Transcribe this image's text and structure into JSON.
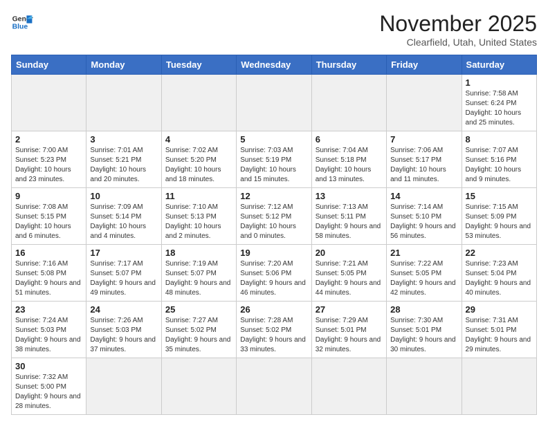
{
  "header": {
    "logo_line1": "General",
    "logo_line2": "Blue",
    "title": "November 2025",
    "subtitle": "Clearfield, Utah, United States"
  },
  "days_of_week": [
    "Sunday",
    "Monday",
    "Tuesday",
    "Wednesday",
    "Thursday",
    "Friday",
    "Saturday"
  ],
  "weeks": [
    [
      {
        "day": "",
        "info": ""
      },
      {
        "day": "",
        "info": ""
      },
      {
        "day": "",
        "info": ""
      },
      {
        "day": "",
        "info": ""
      },
      {
        "day": "",
        "info": ""
      },
      {
        "day": "",
        "info": ""
      },
      {
        "day": "1",
        "info": "Sunrise: 7:58 AM\nSunset: 6:24 PM\nDaylight: 10 hours\nand 25 minutes."
      }
    ],
    [
      {
        "day": "2",
        "info": "Sunrise: 7:00 AM\nSunset: 5:23 PM\nDaylight: 10 hours\nand 23 minutes."
      },
      {
        "day": "3",
        "info": "Sunrise: 7:01 AM\nSunset: 5:21 PM\nDaylight: 10 hours\nand 20 minutes."
      },
      {
        "day": "4",
        "info": "Sunrise: 7:02 AM\nSunset: 5:20 PM\nDaylight: 10 hours\nand 18 minutes."
      },
      {
        "day": "5",
        "info": "Sunrise: 7:03 AM\nSunset: 5:19 PM\nDaylight: 10 hours\nand 15 minutes."
      },
      {
        "day": "6",
        "info": "Sunrise: 7:04 AM\nSunset: 5:18 PM\nDaylight: 10 hours\nand 13 minutes."
      },
      {
        "day": "7",
        "info": "Sunrise: 7:06 AM\nSunset: 5:17 PM\nDaylight: 10 hours\nand 11 minutes."
      },
      {
        "day": "8",
        "info": "Sunrise: 7:07 AM\nSunset: 5:16 PM\nDaylight: 10 hours\nand 9 minutes."
      }
    ],
    [
      {
        "day": "9",
        "info": "Sunrise: 7:08 AM\nSunset: 5:15 PM\nDaylight: 10 hours\nand 6 minutes."
      },
      {
        "day": "10",
        "info": "Sunrise: 7:09 AM\nSunset: 5:14 PM\nDaylight: 10 hours\nand 4 minutes."
      },
      {
        "day": "11",
        "info": "Sunrise: 7:10 AM\nSunset: 5:13 PM\nDaylight: 10 hours\nand 2 minutes."
      },
      {
        "day": "12",
        "info": "Sunrise: 7:12 AM\nSunset: 5:12 PM\nDaylight: 10 hours\nand 0 minutes."
      },
      {
        "day": "13",
        "info": "Sunrise: 7:13 AM\nSunset: 5:11 PM\nDaylight: 9 hours\nand 58 minutes."
      },
      {
        "day": "14",
        "info": "Sunrise: 7:14 AM\nSunset: 5:10 PM\nDaylight: 9 hours\nand 56 minutes."
      },
      {
        "day": "15",
        "info": "Sunrise: 7:15 AM\nSunset: 5:09 PM\nDaylight: 9 hours\nand 53 minutes."
      }
    ],
    [
      {
        "day": "16",
        "info": "Sunrise: 7:16 AM\nSunset: 5:08 PM\nDaylight: 9 hours\nand 51 minutes."
      },
      {
        "day": "17",
        "info": "Sunrise: 7:17 AM\nSunset: 5:07 PM\nDaylight: 9 hours\nand 49 minutes."
      },
      {
        "day": "18",
        "info": "Sunrise: 7:19 AM\nSunset: 5:07 PM\nDaylight: 9 hours\nand 48 minutes."
      },
      {
        "day": "19",
        "info": "Sunrise: 7:20 AM\nSunset: 5:06 PM\nDaylight: 9 hours\nand 46 minutes."
      },
      {
        "day": "20",
        "info": "Sunrise: 7:21 AM\nSunset: 5:05 PM\nDaylight: 9 hours\nand 44 minutes."
      },
      {
        "day": "21",
        "info": "Sunrise: 7:22 AM\nSunset: 5:05 PM\nDaylight: 9 hours\nand 42 minutes."
      },
      {
        "day": "22",
        "info": "Sunrise: 7:23 AM\nSunset: 5:04 PM\nDaylight: 9 hours\nand 40 minutes."
      }
    ],
    [
      {
        "day": "23",
        "info": "Sunrise: 7:24 AM\nSunset: 5:03 PM\nDaylight: 9 hours\nand 38 minutes."
      },
      {
        "day": "24",
        "info": "Sunrise: 7:26 AM\nSunset: 5:03 PM\nDaylight: 9 hours\nand 37 minutes."
      },
      {
        "day": "25",
        "info": "Sunrise: 7:27 AM\nSunset: 5:02 PM\nDaylight: 9 hours\nand 35 minutes."
      },
      {
        "day": "26",
        "info": "Sunrise: 7:28 AM\nSunset: 5:02 PM\nDaylight: 9 hours\nand 33 minutes."
      },
      {
        "day": "27",
        "info": "Sunrise: 7:29 AM\nSunset: 5:01 PM\nDaylight: 9 hours\nand 32 minutes."
      },
      {
        "day": "28",
        "info": "Sunrise: 7:30 AM\nSunset: 5:01 PM\nDaylight: 9 hours\nand 30 minutes."
      },
      {
        "day": "29",
        "info": "Sunrise: 7:31 AM\nSunset: 5:01 PM\nDaylight: 9 hours\nand 29 minutes."
      }
    ],
    [
      {
        "day": "30",
        "info": "Sunrise: 7:32 AM\nSunset: 5:00 PM\nDaylight: 9 hours\nand 28 minutes."
      },
      {
        "day": "",
        "info": ""
      },
      {
        "day": "",
        "info": ""
      },
      {
        "day": "",
        "info": ""
      },
      {
        "day": "",
        "info": ""
      },
      {
        "day": "",
        "info": ""
      },
      {
        "day": "",
        "info": ""
      }
    ]
  ]
}
